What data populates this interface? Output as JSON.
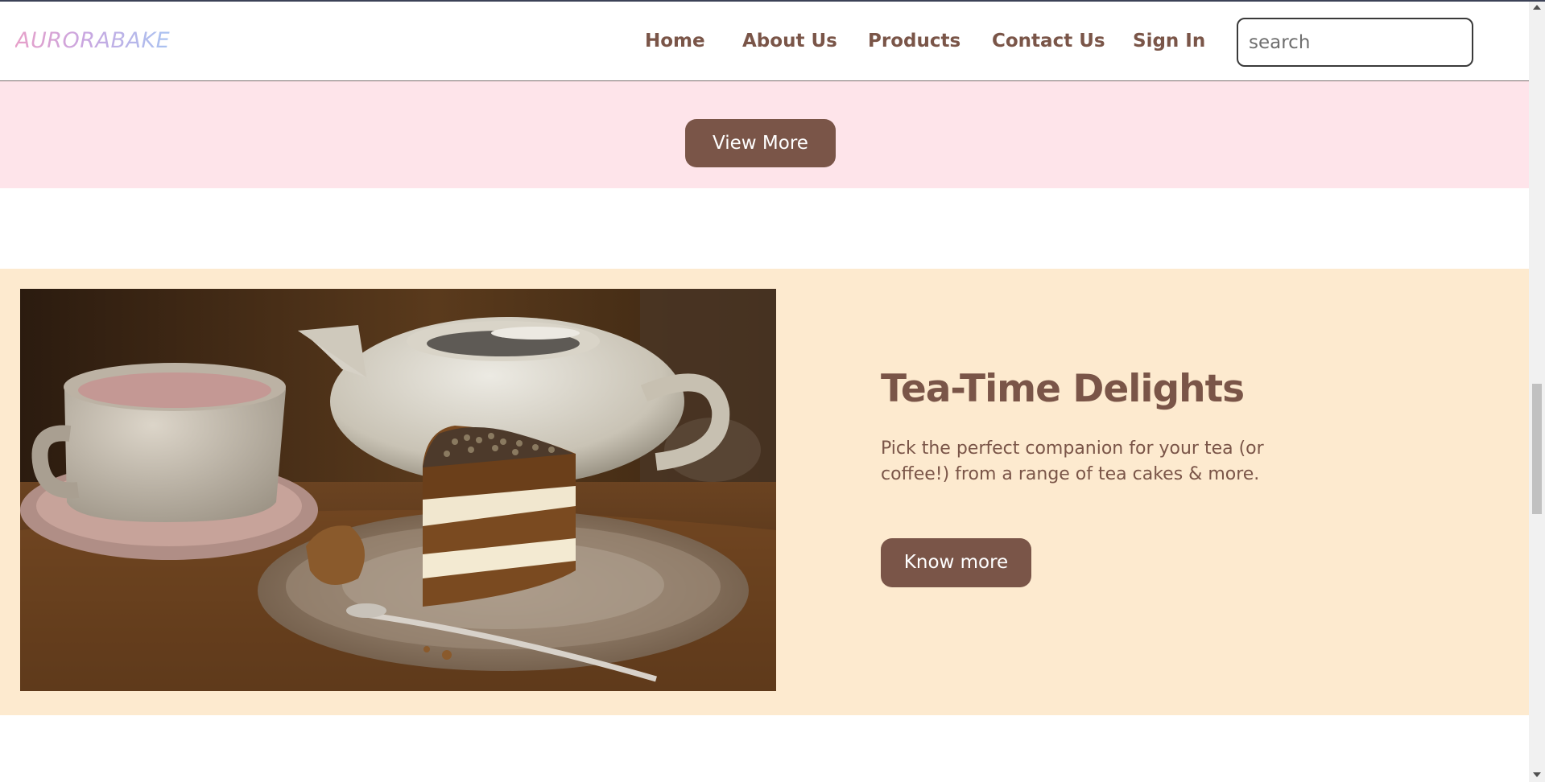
{
  "header": {
    "logo": "AURORABAKE",
    "nav": {
      "home": "Home",
      "about": "About Us",
      "products": "Products",
      "contact": "Contact Us",
      "signin": "Sign In"
    },
    "search_placeholder": "search"
  },
  "promo_band": {
    "button_label": "View More"
  },
  "tea_section": {
    "title": "Tea-Time Delights",
    "description": "Pick the perfect companion for your tea (or coffee!) from a range of tea cakes & more.",
    "button_label": "Know more",
    "image": "cake-and-teapot-photo"
  },
  "colors": {
    "brand_brown": "#7a5548",
    "pink_band": "#fee4ea",
    "peach_band": "#fdeacf",
    "logo_gradient": [
      "#e7a0c9",
      "#c9a6e0",
      "#a9c3f1"
    ]
  }
}
